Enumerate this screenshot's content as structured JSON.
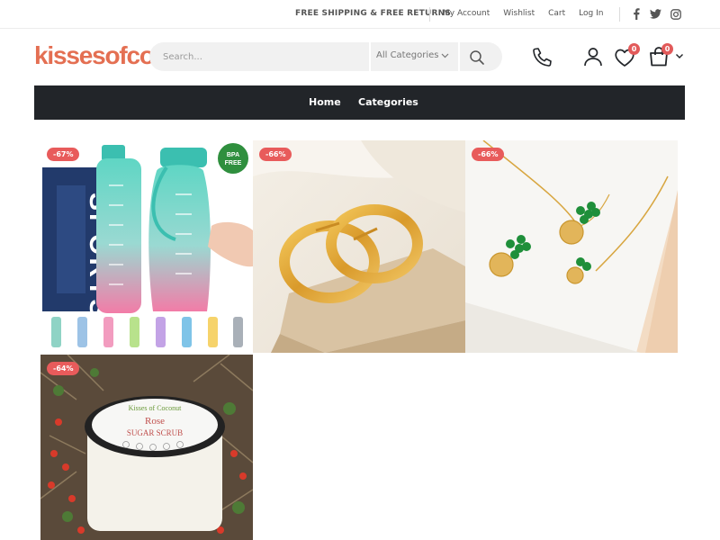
{
  "topbar": {
    "shipping_text": "FREE SHIPPING & FREE RETURNS",
    "links": [
      "My Account",
      "Wishlist",
      "Cart",
      "Log In"
    ],
    "social_icons": [
      "facebook-icon",
      "twitter-icon",
      "instagram-icon"
    ]
  },
  "header": {
    "logo_text": "kissesofcoconut",
    "search": {
      "placeholder": "Search...",
      "value": ""
    },
    "category_select": "All Categories",
    "wishlist_count": "0",
    "cart_count": "0",
    "icons": [
      "phone-icon",
      "user-icon",
      "heart-icon",
      "cart-icon"
    ]
  },
  "nav": {
    "items": [
      "Home",
      "Categories"
    ]
  },
  "products": [
    {
      "discount": "-67%",
      "image": "sports-water-bottle"
    },
    {
      "discount": "-66%",
      "image": "gold-hoop-earrings"
    },
    {
      "discount": "-66%",
      "image": "green-bead-jewelry-set"
    },
    {
      "discount": "-64%",
      "image": "rose-sugar-scrub-jar"
    }
  ],
  "colors": {
    "brand": "#e46f52",
    "nav_bg": "#222529",
    "badge": "#e85b5b"
  }
}
